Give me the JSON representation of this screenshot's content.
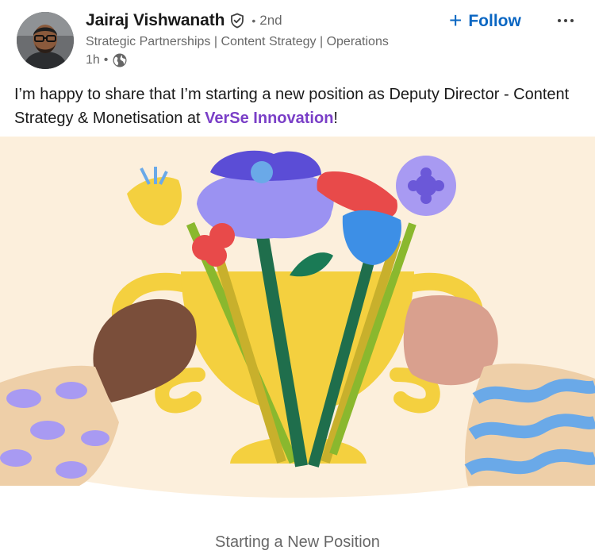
{
  "post": {
    "author": {
      "name": "Jairaj Vishwanath",
      "verified_icon": "verified-shield-icon",
      "connection_degree": "2nd",
      "degree_separator": "•",
      "headline": "Strategic Partnerships | Content Strategy | Operations",
      "time_ago": "1h",
      "time_separator": "•",
      "visibility_icon": "globe-icon"
    },
    "actions": {
      "follow_icon": "+",
      "follow_label": "Follow",
      "more_icon": "more-dots-icon"
    },
    "body": {
      "text_before_mention": "I’m happy to share that I’m starting a new position as Deputy Director - Content Strategy & Monetisation at ",
      "mention": "VerSe Innovation",
      "text_after_mention": "!"
    },
    "media": {
      "image_subject": "celebration-bouquet-illustration",
      "caption": "Starting a New Position"
    },
    "colors": {
      "link_blue": "#0a66c2",
      "mention_purple": "#7a3fc7",
      "illustration_bg": "#fcefdc"
    }
  }
}
